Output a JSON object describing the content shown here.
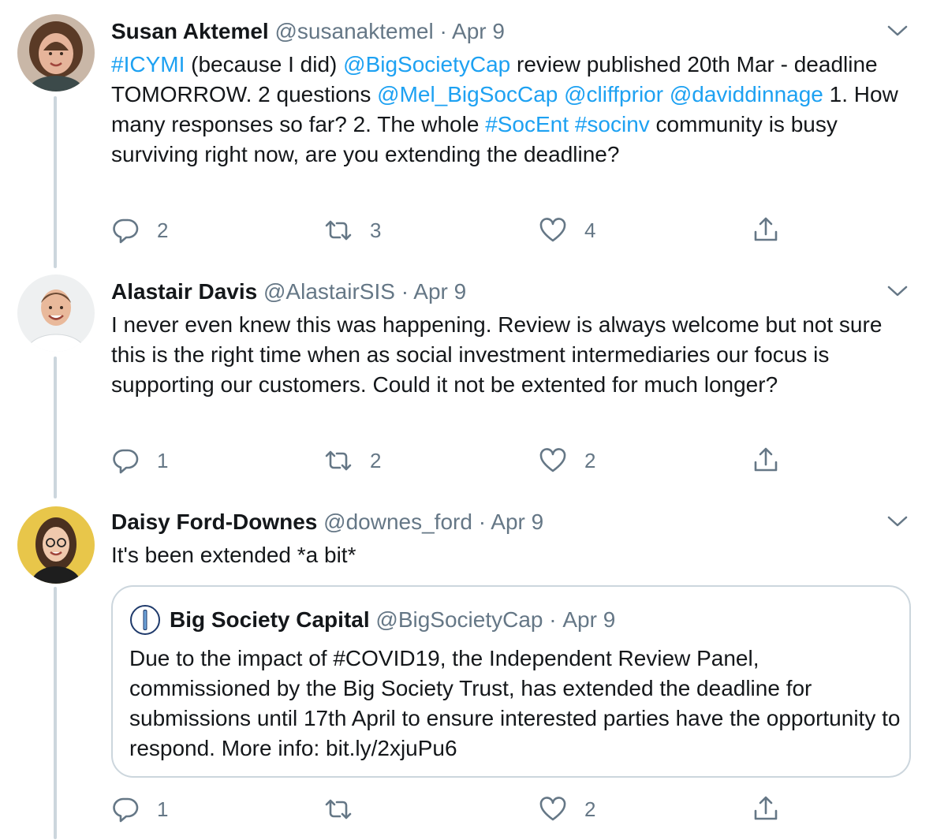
{
  "tweets": [
    {
      "name": "Susan Aktemel",
      "handle": "@susanaktemel",
      "separator": "·",
      "date": "Apr 9",
      "body": [
        {
          "t": "#ICYMI",
          "link": true
        },
        {
          "t": " (because I did) ",
          "link": false
        },
        {
          "t": "@BigSocietyCap",
          "link": true
        },
        {
          "t": " review published 20th Mar - deadline TOMORROW. 2 questions ",
          "link": false
        },
        {
          "t": "@Mel_BigSocCap",
          "link": true
        },
        {
          "t": " ",
          "link": false
        },
        {
          "t": "@cliffprior",
          "link": true
        },
        {
          "t": " ",
          "link": false
        },
        {
          "t": "@daviddinnage",
          "link": true
        },
        {
          "t": " 1. How many responses so far? 2. The whole ",
          "link": false
        },
        {
          "t": "#SocEnt",
          "link": true
        },
        {
          "t": " ",
          "link": false
        },
        {
          "t": "#socinv",
          "link": true
        },
        {
          "t": " community is busy surviving right now, are you extending the deadline?",
          "link": false
        }
      ],
      "reply_count": "2",
      "retweet_count": "3",
      "like_count": "4"
    },
    {
      "name": "Alastair Davis",
      "handle": "@AlastairSIS",
      "separator": "·",
      "date": "Apr 9",
      "body": [
        {
          "t": "I never even knew this was happening. Review is always welcome but not sure this is the right time when as social investment intermediaries our focus is supporting our customers. Could it not be extented for much longer?",
          "link": false
        }
      ],
      "reply_count": "1",
      "retweet_count": "2",
      "like_count": "2"
    },
    {
      "name": "Daisy Ford-Downes",
      "handle": "@downes_ford",
      "separator": "·",
      "date": "Apr 9",
      "body": [
        {
          "t": "It's been extended *a bit*",
          "link": false
        }
      ],
      "reply_count": "1",
      "retweet_count": "",
      "like_count": "2"
    }
  ],
  "quote": {
    "name": "Big Society Capital",
    "handle": "@BigSocietyCap",
    "separator": "·",
    "date": "Apr 9",
    "body": "Due to the impact of #COVID19, the Independent Review Panel, commissioned by the Big Society Trust, has extended the deadline for submissions until 17th April to ensure interested parties have the opportunity to respond. More info: bit.ly/2xjuPu6"
  },
  "icons": {
    "reply": "reply-icon",
    "retweet": "retweet-icon",
    "like": "heart-icon",
    "share": "share-icon",
    "more": "chevron-down-icon"
  },
  "colors": {
    "link": "#1da1f2",
    "secondary_text": "#657786",
    "thread_line": "#ccd6dd",
    "text": "#14171a"
  }
}
